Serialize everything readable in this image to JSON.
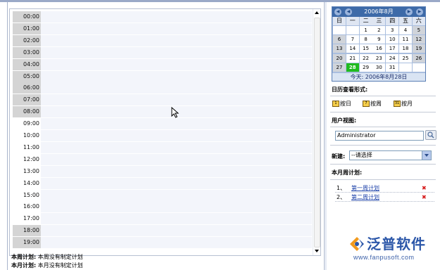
{
  "schedule": {
    "hours": [
      "00:00",
      "01:00",
      "02:00",
      "03:00",
      "04:00",
      "05:00",
      "06:00",
      "07:00",
      "08:00",
      "09:00",
      "10:00",
      "11:00",
      "12:00",
      "13:00",
      "14:00",
      "15:00",
      "16:00",
      "17:00",
      "18:00",
      "19:00"
    ]
  },
  "plans": {
    "week_label": "本周计划:",
    "week_text": "本周没有制定计划",
    "month_label": "本月计划:",
    "month_text": "本月没有制定计划"
  },
  "calendar": {
    "nav": {
      "prev_year": "◀",
      "prev_month": "◀",
      "next_month": "▶",
      "next_year": "▶"
    },
    "title": "2006年8月",
    "weekdays": [
      "日",
      "一",
      "二",
      "三",
      "四",
      "五",
      "六"
    ],
    "days": [
      "",
      "",
      "1",
      "2",
      "3",
      "4",
      "5",
      "6",
      "7",
      "8",
      "9",
      "10",
      "11",
      "12",
      "13",
      "14",
      "15",
      "16",
      "17",
      "18",
      "19",
      "20",
      "21",
      "22",
      "23",
      "24",
      "25",
      "26",
      "27",
      "28",
      "29",
      "30",
      "31",
      "",
      ""
    ],
    "today_text": "今天: 2006年8月28日"
  },
  "view_mode": {
    "title": "日历查看形式:",
    "day": {
      "icon": "1",
      "label": "按日"
    },
    "week": {
      "icon": "7",
      "label": "按周"
    },
    "month": {
      "icon": "31",
      "label": "按月"
    }
  },
  "user_view": {
    "title": "用户视图:",
    "value": "Administrator"
  },
  "new_item": {
    "label": "新建:",
    "selected": "--请选择"
  },
  "month_week_plans": {
    "title": "本月周计划:",
    "items": [
      {
        "num": "1、",
        "label": "第一周计划"
      },
      {
        "num": "2、",
        "label": "第二周计划"
      }
    ]
  },
  "logo": {
    "name": "泛普软件",
    "url": "www.fanpusoft.com"
  },
  "colors": {
    "calendar_header": "#3d6aa8",
    "today": "#1fbb1f",
    "link": "#1a3fa8",
    "delete": "#d61b1b"
  }
}
